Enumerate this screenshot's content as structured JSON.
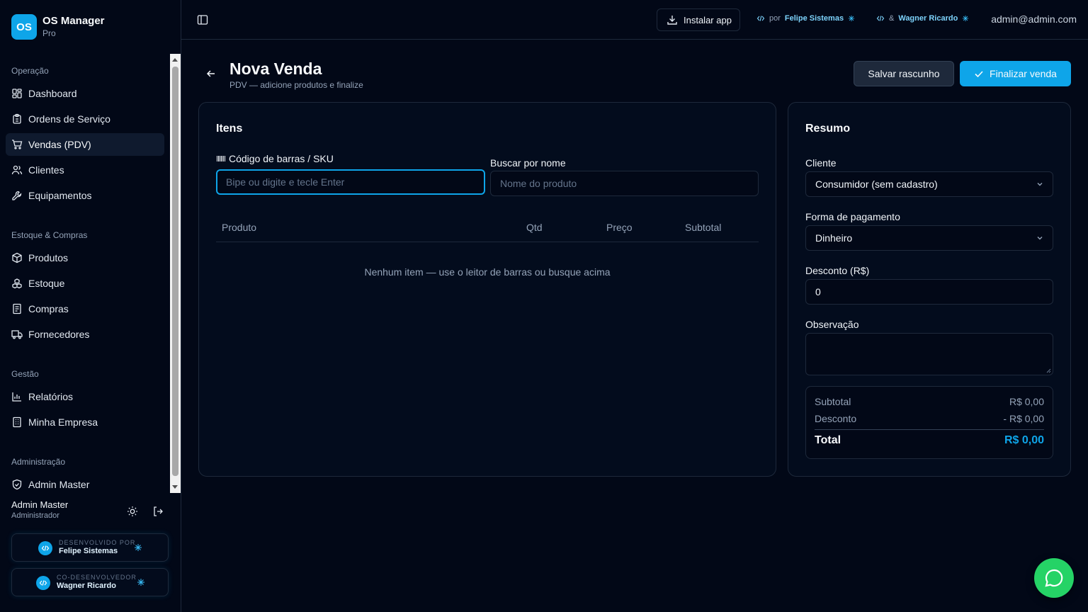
{
  "brand": {
    "logo": "OS",
    "name": "OS Manager",
    "plan": "Pro"
  },
  "nav": {
    "sections": [
      {
        "title": "Operação",
        "items": [
          "Dashboard",
          "Ordens de Serviço",
          "Vendas (PDV)",
          "Clientes",
          "Equipamentos"
        ]
      },
      {
        "title": "Estoque & Compras",
        "items": [
          "Produtos",
          "Estoque",
          "Compras",
          "Fornecedores"
        ]
      },
      {
        "title": "Gestão",
        "items": [
          "Relatórios",
          "Minha Empresa"
        ]
      },
      {
        "title": "Administração",
        "items": [
          "Admin Master"
        ]
      }
    ],
    "active": "Vendas (PDV)"
  },
  "user": {
    "name": "Admin Master",
    "role": "Administrador"
  },
  "devs": [
    {
      "caption": "DESENVOLVIDO POR",
      "name": "Felipe Sistemas"
    },
    {
      "caption": "CO-DESENVOLVEDOR",
      "name": "Wagner Ricardo"
    }
  ],
  "header": {
    "install_label": "Instalar app",
    "credit1_prefix": "por",
    "credit1_name": "Felipe Sistemas",
    "credit2_prefix": "&",
    "credit2_name": "Wagner Ricardo",
    "email": "admin@admin.com"
  },
  "page": {
    "title": "Nova Venda",
    "subtitle": "PDV — adicione produtos e finalize",
    "save_draft": "Salvar rascunho",
    "finish": "Finalizar venda"
  },
  "items_card": {
    "title": "Itens",
    "barcode_label": "Código de barras / SKU",
    "barcode_placeholder": "Bipe ou digite e tecle Enter",
    "search_label": "Buscar por nome",
    "search_placeholder": "Nome do produto",
    "columns": [
      "Produto",
      "Qtd",
      "Preço",
      "Subtotal"
    ],
    "empty": "Nenhum item — use o leitor de barras ou busque acima"
  },
  "summary_card": {
    "title": "Resumo",
    "client_label": "Cliente",
    "client_value": "Consumidor (sem cadastro)",
    "payment_label": "Forma de pagamento",
    "payment_value": "Dinheiro",
    "discount_label": "Desconto (R$)",
    "discount_value": "0",
    "note_label": "Observação",
    "note_value": "",
    "subtotal_label": "Subtotal",
    "subtotal_value": "R$ 0,00",
    "discount_row_label": "Desconto",
    "discount_row_value": "- R$ 0,00",
    "total_label": "Total",
    "total_value": "R$ 0,00"
  },
  "colors": {
    "accent": "#0ea5e9",
    "background": "#020817",
    "whatsapp": "#25d366"
  }
}
